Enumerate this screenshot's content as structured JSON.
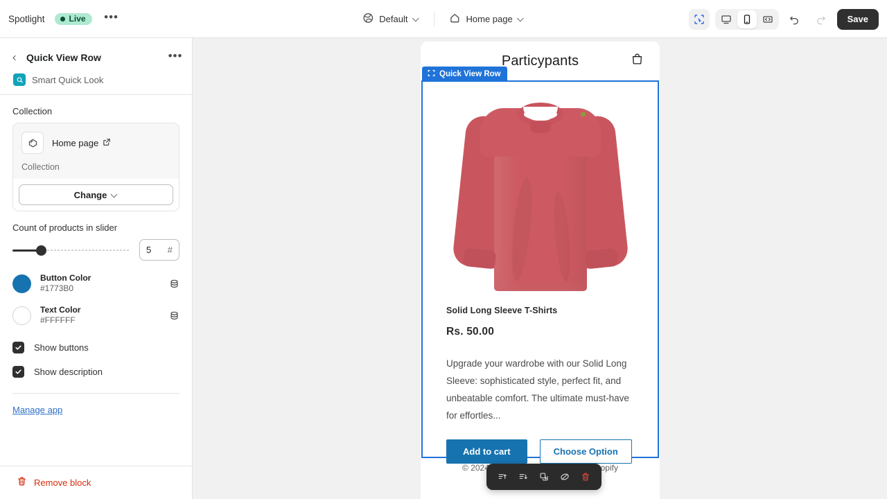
{
  "topbar": {
    "shop_name": "Spotlight",
    "live_label": "Live",
    "more_label": "•••",
    "theme_selector": "Default",
    "page_selector": "Home page",
    "save_label": "Save",
    "icons": {
      "globe": "globe-icon",
      "home": "home-icon",
      "inspect": "inspect-icon",
      "desktop": "desktop-icon",
      "mobile": "mobile-icon",
      "fullscreen": "fullscreen-icon",
      "undo": "undo-icon",
      "redo": "redo-icon"
    }
  },
  "sidebar": {
    "title": "Quick View Row",
    "more_label": "•••",
    "app_name": "Smart Quick Look",
    "collection_label": "Collection",
    "resource": {
      "name": "Home page",
      "subtitle": "Collection",
      "change_label": "Change"
    },
    "count_label": "Count of products in slider",
    "count_value": "5",
    "count_suffix": "#",
    "colors": [
      {
        "name": "Button Color",
        "hex": "#1773B0",
        "swatch": "#1773B0"
      },
      {
        "name": "Text Color",
        "hex": "#FFFFFF",
        "swatch": "#FFFFFF"
      }
    ],
    "checkboxes": [
      {
        "label": "Show buttons",
        "checked": true
      },
      {
        "label": "Show description",
        "checked": true
      }
    ],
    "manage_app_label": "Manage app",
    "remove_block_label": "Remove block"
  },
  "preview": {
    "store_title": "Particypants",
    "selection_label": "Quick View Row",
    "product": {
      "title": "Solid Long Sleeve T-Shirts",
      "price": "Rs. 50.00",
      "description": "Upgrade your wardrobe with our Solid Long Sleeve: sophisticated style, perfect fit, and unbeatable comfort. The ultimate must-have for effortles...",
      "add_to_cart_label": "Add to cart",
      "choose_option_label": "Choose Option",
      "image_alt": "red-long-sleeve-tshirt"
    },
    "footer_text": "© 2024, Particypants. Powered by Shopify",
    "toolbar": {
      "move_up": "move-up-icon",
      "move_down": "move-down-icon",
      "duplicate": "duplicate-icon",
      "hide": "hide-icon",
      "delete": "delete-icon"
    }
  },
  "theme": {
    "accent_blue": "#1773B0",
    "selection_blue": "#1f73d9",
    "live_green_bg": "#aee9d1",
    "live_green_fg": "#0c5132",
    "danger_red": "#d72c0d",
    "link_blue": "#2c6ecb",
    "shirt_red": "#cd5a62"
  }
}
